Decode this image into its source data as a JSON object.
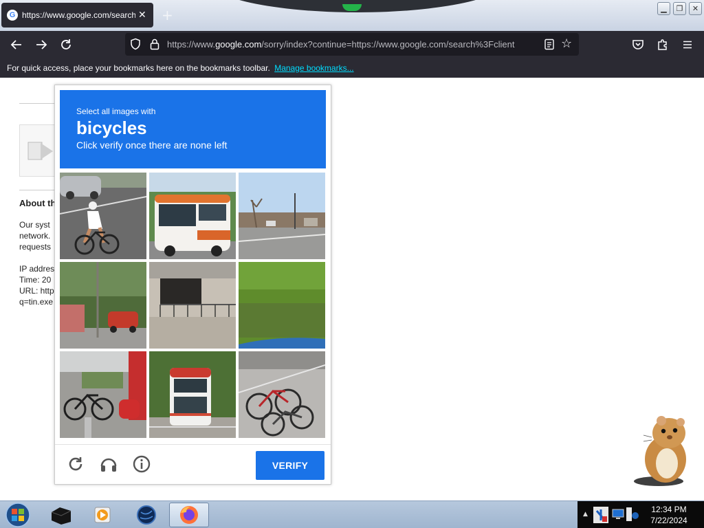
{
  "browser": {
    "tab_title": "https://www.google.com/search",
    "tab_close": "✕",
    "new_tab": "+",
    "url_prefix": "https://www.",
    "url_domain": "google.com",
    "url_rest": "/sorry/index?continue=https://www.google.com/search%3Fclient",
    "bookmarks_text": "For quick access, place your bookmarks here on the bookmarks toolbar.",
    "bookmarks_link": "Manage bookmarks..."
  },
  "page": {
    "heading": "About th",
    "lines": [
      "Our syst",
      "network.",
      "requests",
      "IP addres",
      "Time: 20",
      "URL: http",
      "q=tin.exe"
    ]
  },
  "captcha": {
    "instruction": "Select all images with",
    "target": "bicycles",
    "subtext": "Click verify once there are none left",
    "verify_label": "VERIFY",
    "tiles": [
      "cyclist-on-road",
      "orange-white-bus",
      "street-with-trees",
      "street-with-red-car",
      "building-balcony",
      "grass-hedge",
      "parked-bicycles-scooter",
      "double-decker-bus",
      "bicycles-in-rack"
    ]
  },
  "taskbar": {
    "time": "12:34 PM",
    "date": "7/22/2024"
  },
  "colors": {
    "captcha_blue": "#1a73e8",
    "browser_dark": "#2b2a33",
    "link_cyan": "#00ddff"
  }
}
